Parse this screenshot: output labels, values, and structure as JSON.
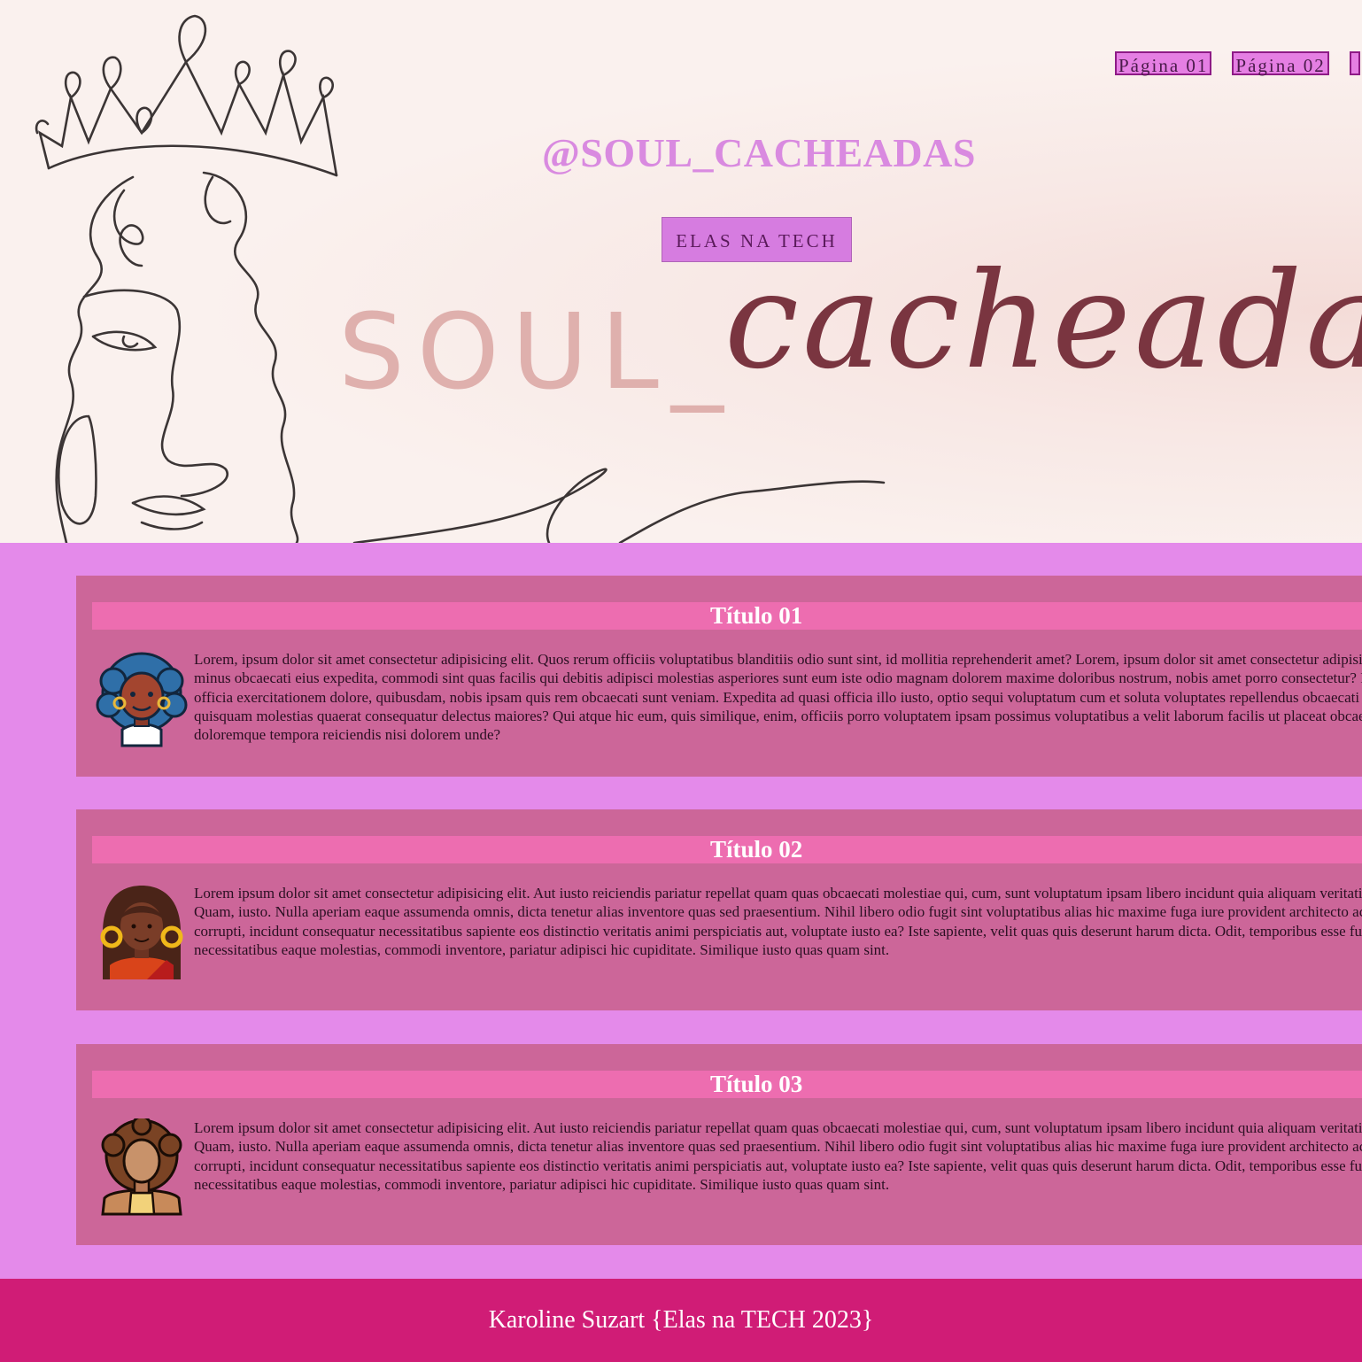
{
  "nav": {
    "links": [
      "Página 01",
      "Página 02",
      ""
    ]
  },
  "header": {
    "handle": "@SOUL_CACHEADAS",
    "cta_label": "ELAS NA TECH",
    "logo_text_block": "SOUL_",
    "logo_text_script": "cacheadas"
  },
  "cards": [
    {
      "title": "Título 01",
      "avatar": "curly-blue-hair-woman-avatar-icon",
      "text": "Lorem, ipsum dolor sit amet consectetur adipisicing elit. Quos rerum officiis voluptatibus blanditiis odio sunt sint, id mollitia reprehenderit amet? Lorem, ipsum dolor sit amet consectetur adipisicing elit. Quos minus obcaecati eius expedita, commodi sint quas facilis qui debitis adipisci molestias asperiores sunt eum iste odio magnam dolorem maxime doloribus nostrum, nobis amet porro consectetur? Modi minus officia exercitationem dolore, quibusdam, nobis ipsam quis rem obcaecati sunt veniam. Expedita ad quasi officia illo iusto, optio sequi voluptatum cum et soluta voluptates repellendus obcaecati sint neque quisquam molestias quaerat consequatur delectus maiores? Qui atque hic eum, quis similique, enim, officiis porro voluptatem ipsam possimus voluptatibus a velit laborum facilis ut placeat obcaecati rem doloremque tempora reiciendis nisi dolorem unde?"
    },
    {
      "title": "Título 02",
      "avatar": "braided-hair-woman-avatar-icon",
      "text": "Lorem ipsum dolor sit amet consectetur adipisicing elit. Aut iusto reiciendis pariatur repellat quam quas obcaecati molestiae qui, cum, sunt voluptatum ipsam libero incidunt quia aliquam veritatis doloribus! Quam, iusto. Nulla aperiam eaque assumenda omnis, dicta tenetur alias inventore quas sed praesentium. Nihil libero odio fugit sint voluptatibus alias hic maxime fuga iure provident architecto accusantium corrupti, incidunt consequatur necessitatibus sapiente eos distinctio veritatis animi perspiciatis aut, voluptate iusto ea? Iste sapiente, velit quas quis deserunt harum dicta. Odit, temporibus esse fuga necessitatibus eaque molestias, commodi inventore, pariatur adipisci hic cupiditate. Similique iusto quas quam sint."
    },
    {
      "title": "Título 03",
      "avatar": "afro-hair-woman-avatar-icon",
      "text": "Lorem ipsum dolor sit amet consectetur adipisicing elit. Aut iusto reiciendis pariatur repellat quam quas obcaecati molestiae qui, cum, sunt voluptatum ipsam libero incidunt quia aliquam veritatis doloribus! Quam, iusto. Nulla aperiam eaque assumenda omnis, dicta tenetur alias inventore quas sed praesentium. Nihil libero odio fugit sint voluptatibus alias hic maxime fuga iure provident architecto accusantium corrupti, incidunt consequatur necessitatibus sapiente eos distinctio veritatis animi perspiciatis aut, voluptate iusto ea? Iste sapiente, velit quas quis deserunt harum dicta. Odit, temporibus esse fuga necessitatibus eaque molestias, commodi inventore, pariatur adipisci hic cupiditate. Similique iusto quas quam sint."
    }
  ],
  "footer": {
    "text": "Karoline Suzart {Elas na TECH 2023}"
  },
  "colors": {
    "hero_bg": "#faf0ee",
    "accent_purple": "#d67ce0",
    "main_bg": "#e48aea",
    "card_bg": "#cc6699",
    "title_bar": "#ed6db0",
    "footer_bg": "#d01c76",
    "logo_block": "#dfb0ad",
    "logo_script": "#7a3540"
  }
}
